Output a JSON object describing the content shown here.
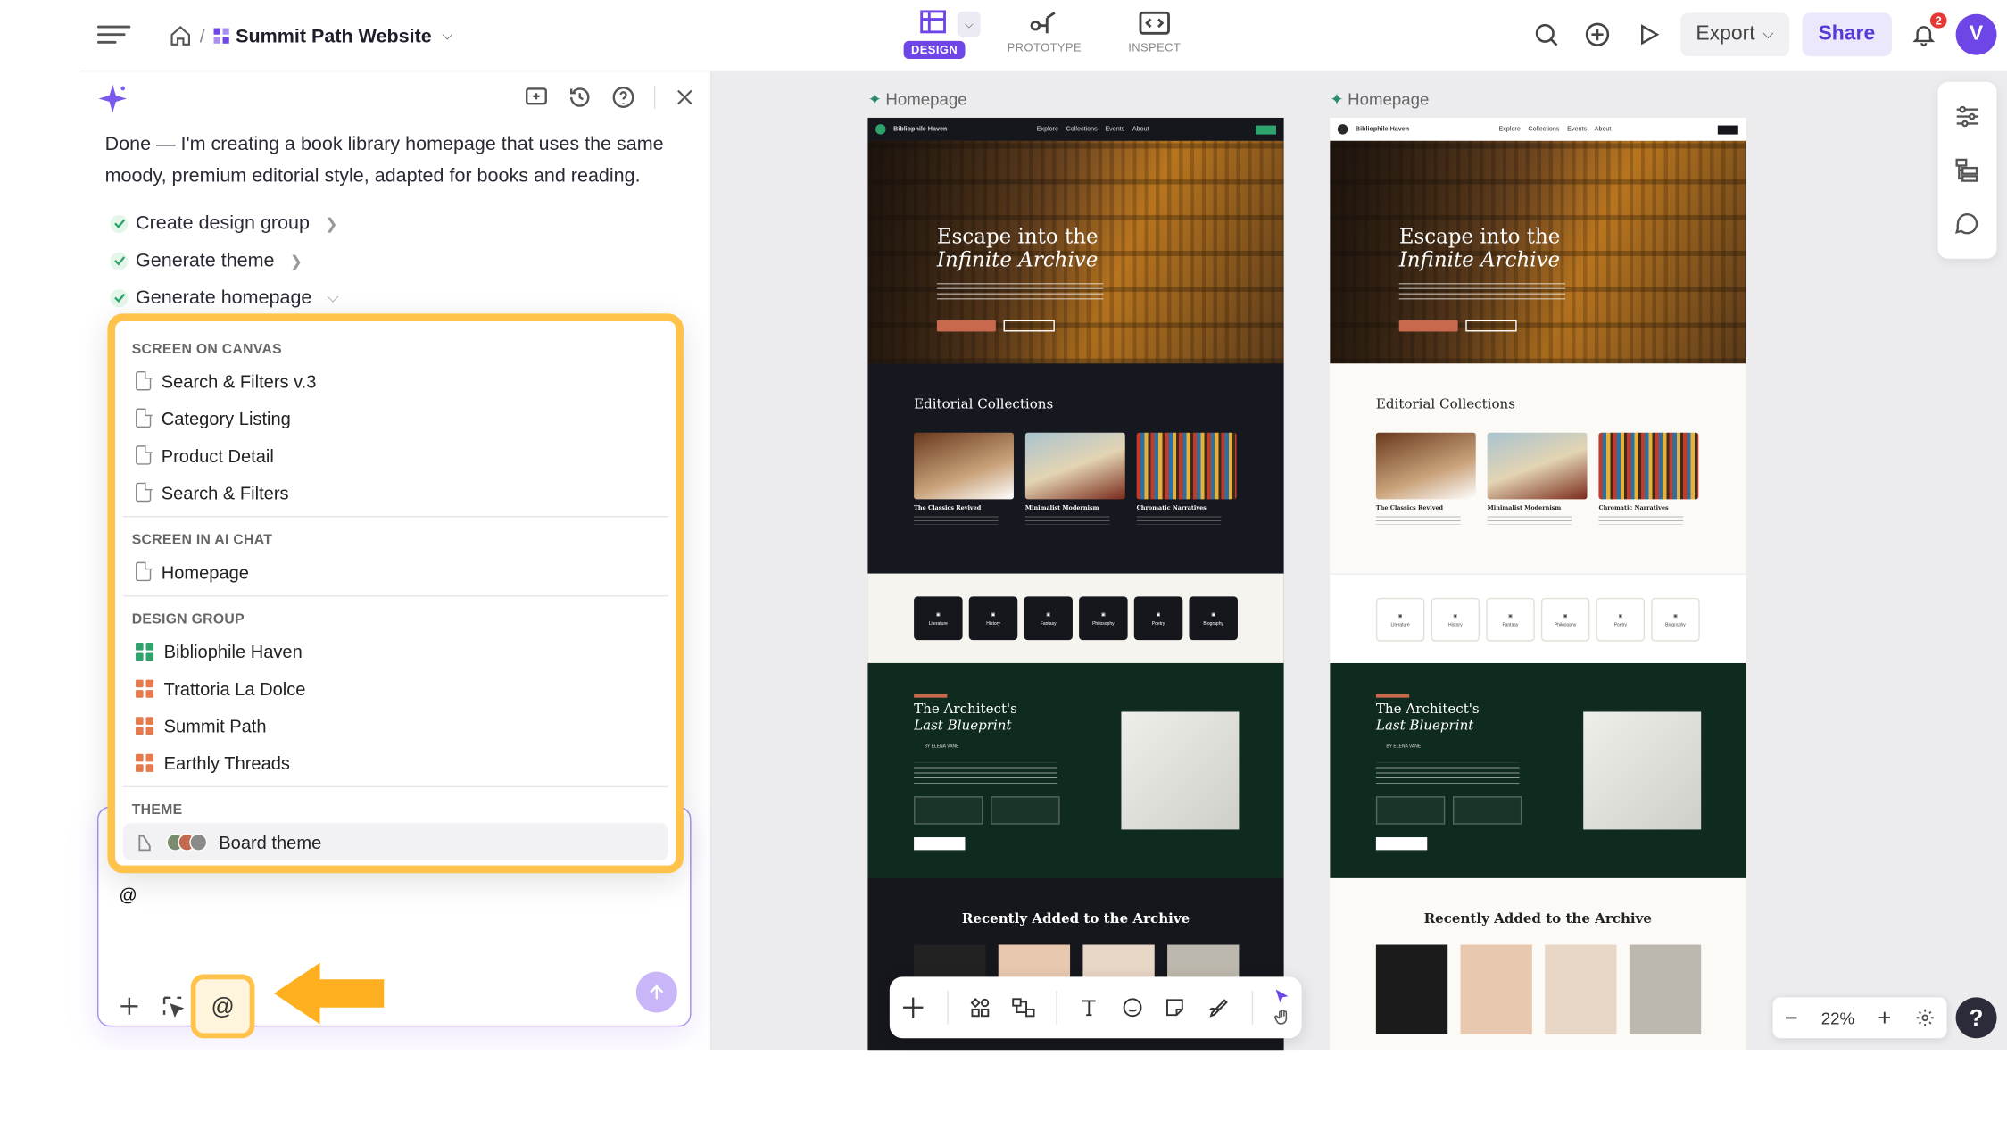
{
  "topbar": {
    "project": "Summit Path Website",
    "modes": [
      {
        "label": "DESIGN"
      },
      {
        "label": "PROTOTYPE"
      },
      {
        "label": "INSPECT"
      }
    ],
    "export_label": "Export",
    "share_label": "Share",
    "notification_count": "2",
    "avatar_initial": "V"
  },
  "chat": {
    "message": "Done — I'm creating a book library homepage that uses the same moody, premium editorial style, adapted for books and reading.",
    "steps": [
      {
        "label": "Create design group"
      },
      {
        "label": "Generate theme"
      },
      {
        "label": "Generate homepage"
      }
    ],
    "input_value": "@"
  },
  "mention_popup": {
    "sections": [
      {
        "title": "SCREEN ON CANVAS",
        "items": [
          "Search & Filters v.3",
          "Category Listing",
          "Product Detail",
          "Search & Filters"
        ]
      },
      {
        "title": "SCREEN IN AI CHAT",
        "items": [
          "Homepage"
        ]
      },
      {
        "title": "DESIGN GROUP",
        "items": [
          "Bibliophile Haven",
          "Trattoria La Dolce",
          "Summit Path",
          "Earthly Threads"
        ]
      },
      {
        "title": "THEME",
        "items": [
          "Board theme"
        ]
      }
    ],
    "group_colors": {
      "active": "#2ea36b",
      "inactive": "#e57a4e"
    },
    "theme_swatches": [
      "#7a8b6f",
      "#c26a4f",
      "#8a8a8a"
    ]
  },
  "canvas": {
    "frames": [
      {
        "label": "Homepage",
        "theme": "dark",
        "brand": "Bibliophile Haven",
        "nav": [
          "Explore",
          "Collections",
          "Events",
          "About"
        ],
        "hero_line1": "Escape into the",
        "hero_line2": "Infinite Archive",
        "collections_title": "Editorial Collections",
        "cards": [
          "The Classics Revived",
          "Minimalist Modernism",
          "Chromatic Narratives"
        ],
        "categories": [
          "Literature",
          "History",
          "Fantasy",
          "Philosophy",
          "Poetry",
          "Biography"
        ],
        "feature_line1": "The Architect's",
        "feature_line2": "Last Blueprint",
        "feature_author": "BY ELENA VANE",
        "recent_title": "Recently Added to the Archive"
      },
      {
        "label": "Homepage",
        "theme": "light",
        "brand": "Bibliophile Haven",
        "nav": [
          "Explore",
          "Collections",
          "Events",
          "About"
        ],
        "hero_line1": "Escape into the",
        "hero_line2": "Infinite Archive",
        "collections_title": "Editorial Collections",
        "cards": [
          "The Classics Revived",
          "Minimalist Modernism",
          "Chromatic Narratives"
        ],
        "categories": [
          "Literature",
          "History",
          "Fantasy",
          "Philosophy",
          "Poetry",
          "Biography"
        ],
        "feature_line1": "The Architect's",
        "feature_line2": "Last Blueprint",
        "feature_author": "BY ELENA VANE",
        "recent_title": "Recently Added to the Archive"
      }
    ],
    "zoom": "22%"
  },
  "colors": {
    "accent": "#6e45e6",
    "highlight": "#ffc24a",
    "dark_frame": "#15171c",
    "feature_green": "#0f2a1e"
  }
}
